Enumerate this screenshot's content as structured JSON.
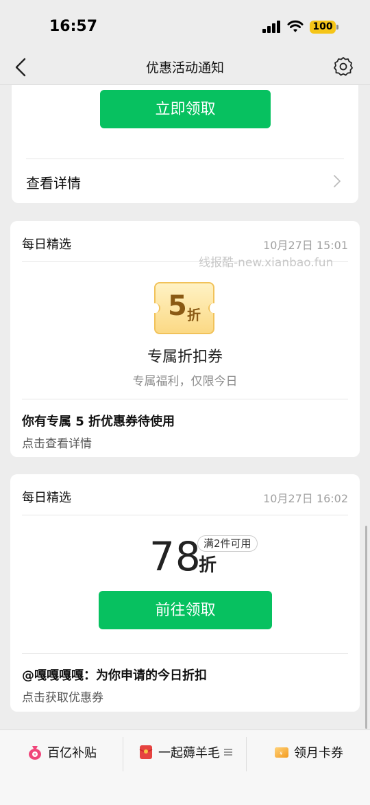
{
  "status_bar": {
    "time": "16:57",
    "battery": "100"
  },
  "nav": {
    "title": "优惠活动通知",
    "back_icon": "chevron-left-icon",
    "settings_icon": "gear-icon"
  },
  "card1": {
    "button_label": "立即领取",
    "detail_label": "查看详情"
  },
  "card2": {
    "tag": "每日精选",
    "time": "10月27日 15:01",
    "coupon_value": "5",
    "coupon_unit": "折",
    "coupon_title": "专属折扣券",
    "coupon_subtitle": "专属福利，仅限今日",
    "message_title": "你有专属 5 折优惠券待使用",
    "message_subtitle": "点击查看详情"
  },
  "watermark": "线报酷-new.xianbao.fun",
  "card3": {
    "tag": "每日精选",
    "time": "10月27日 16:02",
    "discount_value": "78",
    "discount_unit": "折",
    "condition": "满2件可用",
    "button_label": "前往领取",
    "message_title": "@嘎嘎嘎嘎：为你申请的今日折扣",
    "message_subtitle": "点击获取优惠券"
  },
  "bottom_menu": {
    "items": [
      {
        "label": "百亿补贴",
        "icon": "money-bag-icon"
      },
      {
        "label": "一起薅羊毛",
        "icon": "red-packet-icon"
      },
      {
        "label": "领月卡券",
        "icon": "card-voucher-icon"
      }
    ]
  },
  "colors": {
    "accent": "#07c160",
    "background": "#ededed",
    "coupon_gold": "#8a5a14"
  }
}
